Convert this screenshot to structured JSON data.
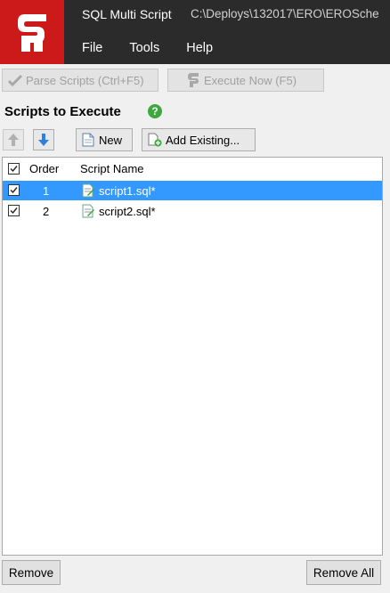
{
  "app": {
    "title": "SQL Multi Script",
    "path": "C:\\Deploys\\132017\\ERO\\EROSche"
  },
  "menu": [
    "File",
    "Tools",
    "Help"
  ],
  "toolbar": {
    "parse_label": "Parse Scripts (Ctrl+F5)",
    "execute_label": "Execute Now (F5)"
  },
  "section": {
    "title": "Scripts to Execute"
  },
  "actions": {
    "new_label": "New",
    "add_existing_label": "Add Existing..."
  },
  "list": {
    "columns": {
      "order": "Order",
      "name": "Script Name"
    },
    "rows": [
      {
        "order": "1",
        "name": "script1.sql*",
        "checked": true,
        "selected": true
      },
      {
        "order": "2",
        "name": "script2.sql*",
        "checked": true,
        "selected": false
      }
    ]
  },
  "footer": {
    "remove_label": "Remove",
    "remove_all_label": "Remove All"
  },
  "colors": {
    "brand_red": "#cc1a1a",
    "selection_blue": "#3399ff",
    "help_green": "#3ea83e"
  }
}
